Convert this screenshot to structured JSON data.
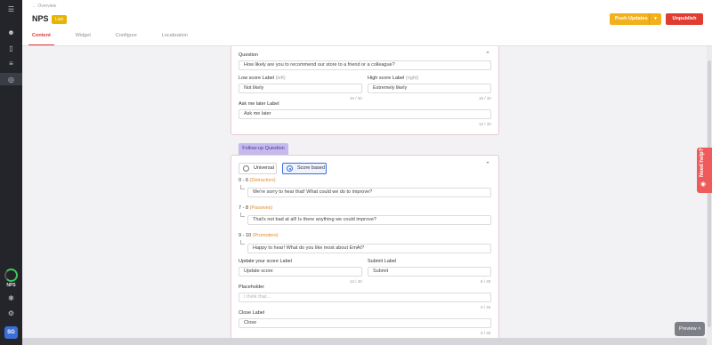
{
  "header": {
    "back_label": "Overview",
    "title": "NPS",
    "status_badge": "Live",
    "tabs": [
      {
        "label": "Content",
        "active": true
      },
      {
        "label": "Widget",
        "active": false
      },
      {
        "label": "Configure",
        "active": false
      },
      {
        "label": "Localization",
        "active": false
      }
    ],
    "push_label": "Push Updates",
    "unpublish_label": "Unpublish"
  },
  "sidebar": {
    "icons": [
      "menu-icon",
      "users-icon",
      "bar-chart-icon",
      "layers-icon",
      "target-icon"
    ],
    "nps_label": "NPS",
    "avatar": "SG",
    "bottom_icons": [
      "settings-icon",
      "gear-icon"
    ]
  },
  "question_card": {
    "question_label": "Question",
    "question_value": "How likely are you to recommend our store to a friend or a colleague?",
    "low_label": "Low score Label",
    "low_hint": "(left)",
    "low_value": "Not likely",
    "low_count": "10 / 40",
    "high_label": "High score Label",
    "high_hint": "(right)",
    "high_value": "Extremely likely",
    "high_count": "16 / 40",
    "later_label": "Ask me later Label",
    "later_value": "Ask me later",
    "later_count": "12 / 40"
  },
  "followup": {
    "tab_label": "Follow-up Question",
    "option_universal": "Universal",
    "option_score": "Score based",
    "selected": "Score based",
    "detractors_range": "0 - 6",
    "detractors_label": "(Detractors)",
    "detractors_value": "We're sorry to hear that! What could we do to improve?",
    "passives_range": "7 - 8",
    "passives_label": "(Passives)",
    "passives_value": "That's not bad at all! Is there anything we could improve?",
    "promoters_range": "9 - 10",
    "promoters_label": "(Promoters)",
    "promoters_value": "Happy to hear! What do you like most about EmAt?",
    "update_label": "Update your score Label",
    "update_value": "Update score",
    "update_count": "12 / 40",
    "submit_label": "Submit Label",
    "submit_value": "Submit",
    "submit_count": "6 / 40",
    "placeholder_label": "Placeholder",
    "placeholder_value": "I think that...",
    "placeholder_count": "0 / 40",
    "close_label": "Close Label",
    "close_value": "Close",
    "close_count": "5 / 40"
  },
  "help_label": "Need help?",
  "preview_label": "Preview",
  "colors": {
    "accent_red": "#d93a3a",
    "push_yellow": "#f2b11a",
    "unpublish_red": "#e03c31",
    "followup_purple": "#c6b9ef",
    "nps_green": "#3fc85a"
  }
}
